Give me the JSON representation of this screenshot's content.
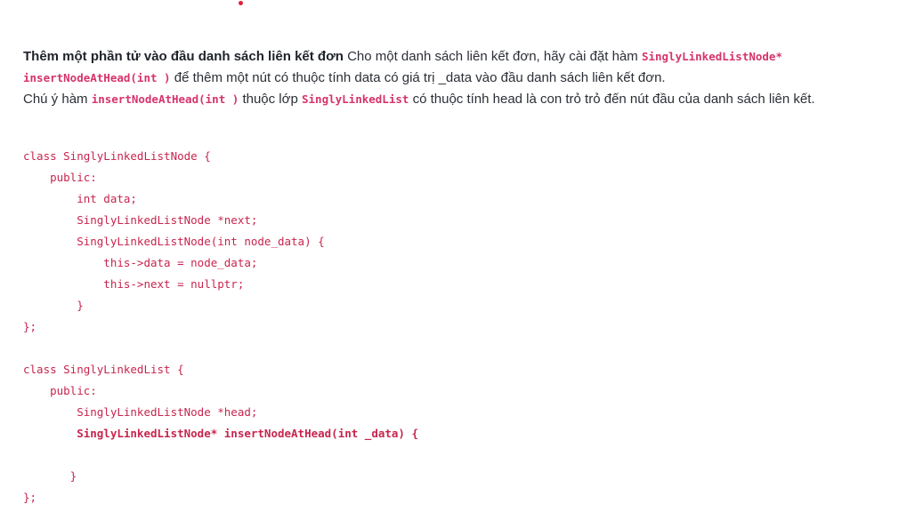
{
  "problem": {
    "title": "Thêm một phần tử vào đầu danh sách liên kết đơn",
    "intro": " Cho một danh sách liên kết đơn, hãy cài đặt hàm ",
    "func_signature_part1": "SinglyLinkedListNode*",
    "func_signature_part2": "insertNodeAtHead(int )",
    "text_after_signature": " để thêm một nút có thuộc tính data có giá trị _data vào đầu danh sách liên kết đơn.",
    "note_prefix": "Chú ý hàm ",
    "note_method": "insertNodeAtHead(int )",
    "note_middle": " thuộc lớp ",
    "note_class": "SinglyLinkedList",
    "note_suffix": " có thuộc tính head là con trỏ trỏ đến nút đầu của danh sách liên kết."
  },
  "code_lines": [
    "class SinglyLinkedListNode {",
    "    public:",
    "        int data;",
    "        SinglyLinkedListNode *next;",
    "        SinglyLinkedListNode(int node_data) {",
    "            this->data = node_data;",
    "            this->next = nullptr;",
    "        }",
    "};",
    "",
    "class SinglyLinkedList {",
    "    public:",
    "        SinglyLinkedListNode *head;",
    "        SinglyLinkedListNode* insertNodeAtHead(int _data) {",
    "",
    "       }",
    "};"
  ]
}
